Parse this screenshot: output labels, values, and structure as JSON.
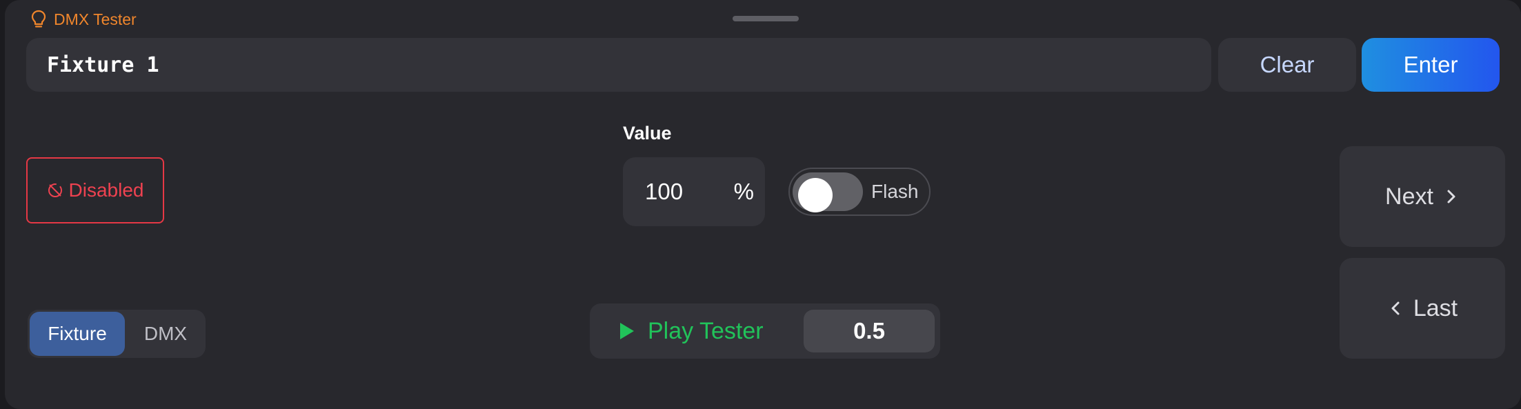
{
  "app": {
    "title": "DMX Tester"
  },
  "input": {
    "value": "Fixture 1"
  },
  "actions": {
    "clear_label": "Clear",
    "enter_label": "Enter"
  },
  "status": {
    "badge_label": "Disabled"
  },
  "value": {
    "label": "Value",
    "amount": "100",
    "unit": "%"
  },
  "flash": {
    "label": "Flash",
    "on": false
  },
  "nav": {
    "next_label": "Next",
    "last_label": "Last"
  },
  "mode": {
    "options": [
      "Fixture",
      "DMX"
    ],
    "selected": "Fixture"
  },
  "tester": {
    "play_label": "Play Tester",
    "speed": "0.5"
  },
  "colors": {
    "background": "#28282d",
    "accent_orange": "#f0862c",
    "danger_red": "#e63845",
    "play_green": "#21c35a",
    "enter_blue": "#2356ee",
    "selected_segment": "#3d5f9c"
  },
  "icons": [
    "lightbulb-icon",
    "disabled-icon",
    "chevron-right-icon",
    "chevron-left-icon",
    "play-icon"
  ]
}
